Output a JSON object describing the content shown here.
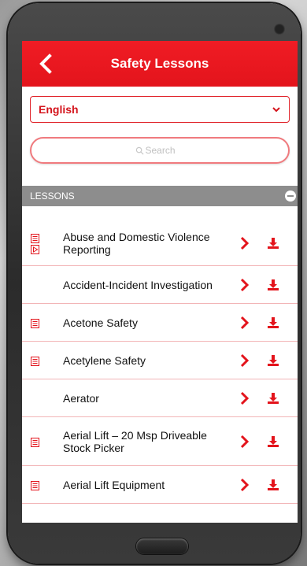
{
  "appbar": {
    "title": "Safety Lessons"
  },
  "language": {
    "selected": "English"
  },
  "search": {
    "placeholder": "Search"
  },
  "section": {
    "label": "LESSONS"
  },
  "lessons": [
    {
      "title": "Abuse and Domestic Violence Reporting",
      "icons": [
        "document",
        "video"
      ]
    },
    {
      "title": "Accident-Incident Investigation",
      "icons": []
    },
    {
      "title": "Acetone Safety",
      "icons": [
        "document"
      ]
    },
    {
      "title": "Acetylene Safety",
      "icons": [
        "document"
      ]
    },
    {
      "title": "Aerator",
      "icons": []
    },
    {
      "title": "Aerial Lift – 20 Msp Driveable Stock Picker",
      "icons": [
        "document"
      ]
    },
    {
      "title": "Aerial Lift Equipment",
      "icons": [
        "document"
      ]
    }
  ],
  "colors": {
    "accent": "#e3141c",
    "header_gray": "#8d8d8d",
    "divider": "#f2b5b7"
  }
}
